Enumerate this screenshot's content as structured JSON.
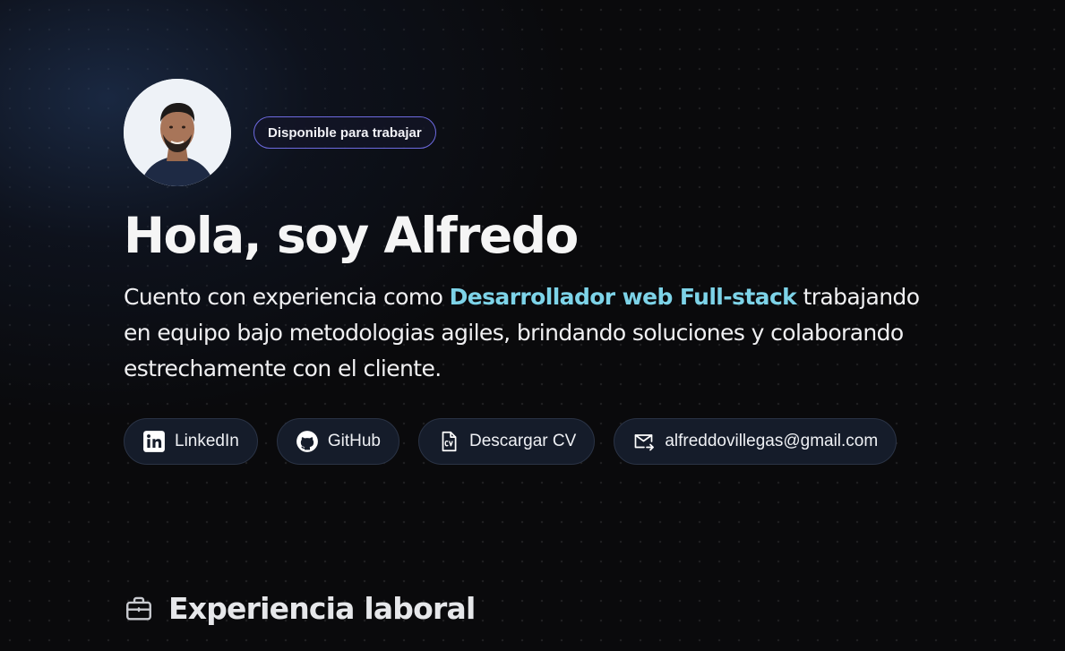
{
  "profile": {
    "avatar_alt": "Alfredo",
    "badge": "Disponible para trabajar"
  },
  "hero": {
    "title": "Hola, soy Alfredo",
    "intro_before": "Cuento con experiencia como ",
    "intro_highlight": "Desarrollador web Full-stack",
    "intro_after": " trabajando en equipo bajo metodologias agiles, brindando soluciones y colaborando estrechamente con el cliente."
  },
  "links": [
    {
      "label": "LinkedIn",
      "icon": "linkedin-icon"
    },
    {
      "label": "GitHub",
      "icon": "github-icon"
    },
    {
      "label": "Descargar CV",
      "icon": "cv-file-icon"
    },
    {
      "label": "alfreddovillegas@gmail.com",
      "icon": "mail-icon"
    }
  ],
  "sections": {
    "experience": {
      "title": "Experiencia laboral",
      "icon": "briefcase-icon"
    }
  },
  "colors": {
    "background": "#0a0a0c",
    "accent": "#7dd3e8",
    "badge_border": "#6d6ae0",
    "button_bg": "#151c2a"
  }
}
